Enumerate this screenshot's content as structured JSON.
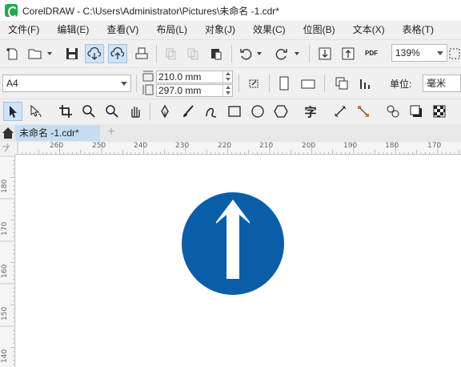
{
  "window": {
    "title": "CorelDRAW - C:\\Users\\Administrator\\Pictures\\未命名 -1.cdr*"
  },
  "menu": [
    "文件(F)",
    "编辑(E)",
    "查看(V)",
    "布局(L)",
    "对象(J)",
    "效果(C)",
    "位图(B)",
    "文本(X)",
    "表格(T)"
  ],
  "toolbar": {
    "zoom": "139%",
    "pdf_label": "PDF"
  },
  "property_bar": {
    "page_size": "A4",
    "width": "210.0 mm",
    "height": "297.0 mm",
    "units_label": "单位:",
    "units_value": "毫米"
  },
  "tabs": {
    "document": "未命名 -1.cdr*",
    "add": "+"
  },
  "ruler": {
    "horizontal": [
      "260",
      "250",
      "240",
      "230",
      "220",
      "210",
      "200",
      "190",
      "180",
      "170"
    ],
    "vertical": [
      "180",
      "170",
      "160",
      "150",
      "140"
    ]
  },
  "colors": {
    "sign_blue": "#0a5ea8",
    "accent": "#2aa84a",
    "tab_active": "#c5dcf1"
  }
}
